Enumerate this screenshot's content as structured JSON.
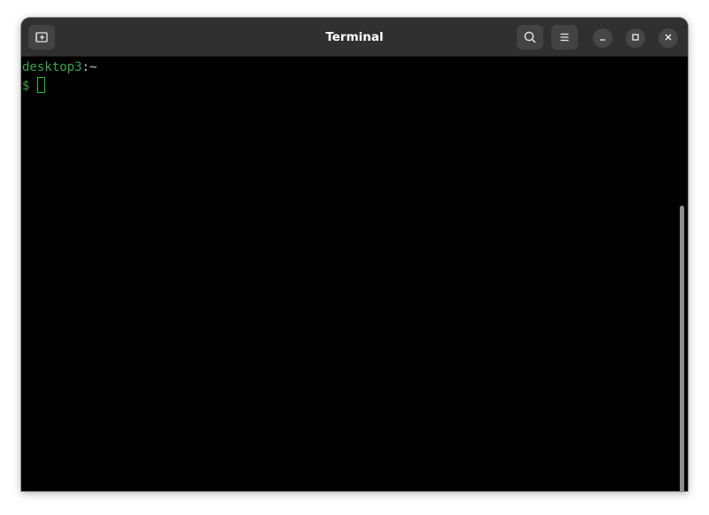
{
  "window": {
    "title": "Terminal"
  },
  "titlebar": {
    "new_tab_icon": "new-tab-icon",
    "search_icon": "search-icon",
    "menu_icon": "hamburger-menu-icon",
    "minimize_icon": "minimize-icon",
    "maximize_icon": "maximize-icon",
    "close_icon": "close-icon"
  },
  "terminal": {
    "host": "desktop3",
    "path": ":~",
    "prompt_symbol": "$"
  },
  "colors": {
    "titlebar_bg": "#303030",
    "terminal_bg": "#000000",
    "prompt_green": "#3aa24c",
    "cursor_green": "#22c32e",
    "button_bg": "#434343"
  }
}
